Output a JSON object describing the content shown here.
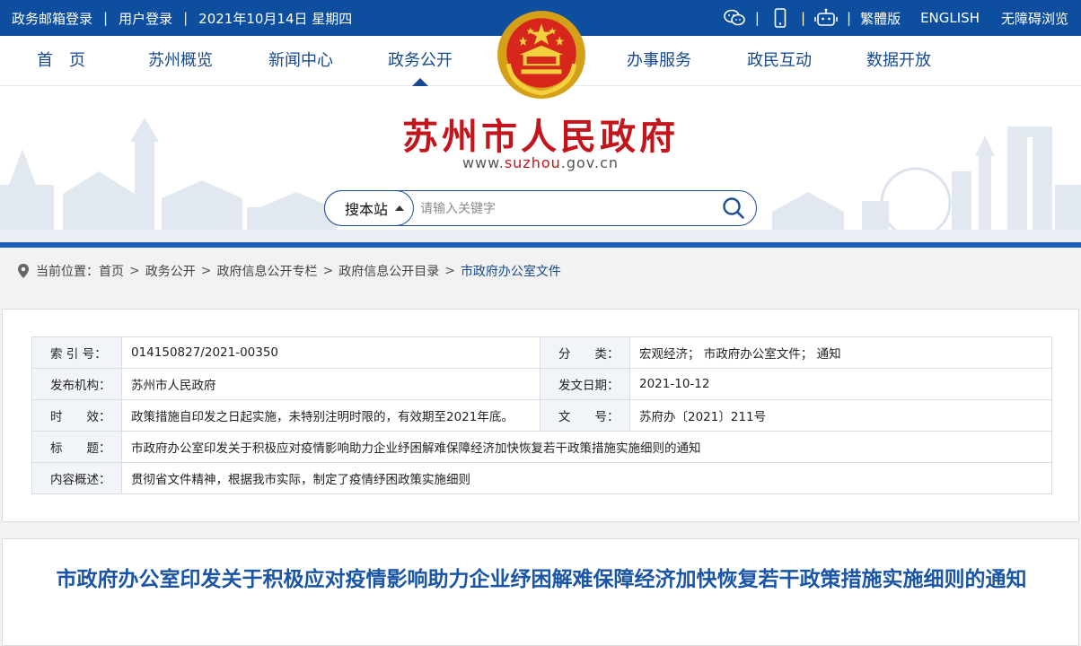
{
  "topbar": {
    "links": [
      "政务邮箱登录",
      "用户登录"
    ],
    "date": "2021年10月14日 星期四",
    "separator": "|",
    "right": [
      "繁體版",
      "ENGLISH",
      "无障碍浏览"
    ],
    "icons": [
      "wechat-icon",
      "mobile-icon",
      "robot-icon"
    ]
  },
  "nav": {
    "items": [
      "首　页",
      "苏州概览",
      "新闻中心",
      "政务公开",
      "办事服务",
      "政民互动",
      "数据开放"
    ],
    "active": "政务公开"
  },
  "header": {
    "title": "苏州市人民政府",
    "url_prefix": "www.",
    "url_highlight": "suzhou",
    "url_suffix": ".gov.cn"
  },
  "search": {
    "scope": "搜本站",
    "placeholder": "请输入关键字"
  },
  "breadcrumb": {
    "label": "当前位置：",
    "items": [
      "首页",
      "政务公开",
      "政府信息公开专栏",
      "政府信息公开目录"
    ],
    "current": "市政府办公室文件",
    "sep": ">"
  },
  "meta": {
    "index_label": "索 引 号：",
    "index_value": "014150827/2021-00350",
    "category_label": "分　　类：",
    "category_value": "宏观经济；  市政府办公室文件；  通知",
    "publisher_label": "发布机构：",
    "publisher_value": "苏州市人民政府",
    "date_label": "发文日期：",
    "date_value": "2021-10-12",
    "validity_label": "时　　效：",
    "validity_value": "政策措施自印发之日起实施，未特别注明时限的，有效期至2021年底。",
    "docno_label": "文　　号：",
    "docno_value": "苏府办〔2021〕211号",
    "title_label": "标　　题：",
    "title_value": "市政府办公室印发关于积极应对疫情影响助力企业纾困解难保障经济加快恢复若干政策措施实施细则的通知",
    "summary_label": "内容概述：",
    "summary_value": "贯彻省文件精神，根据我市实际，制定了疫情纾困政策实施细则"
  },
  "article": {
    "title": "市政府办公室印发关于积极应对疫情影响助力企业纾困解难保障经济加快恢复若干政策措施实施细则的通知"
  },
  "colors": {
    "primary": "#0d4e9e",
    "nav_text": "#16498f",
    "title_red": "#c3161c",
    "article_title": "#1a56a5"
  }
}
